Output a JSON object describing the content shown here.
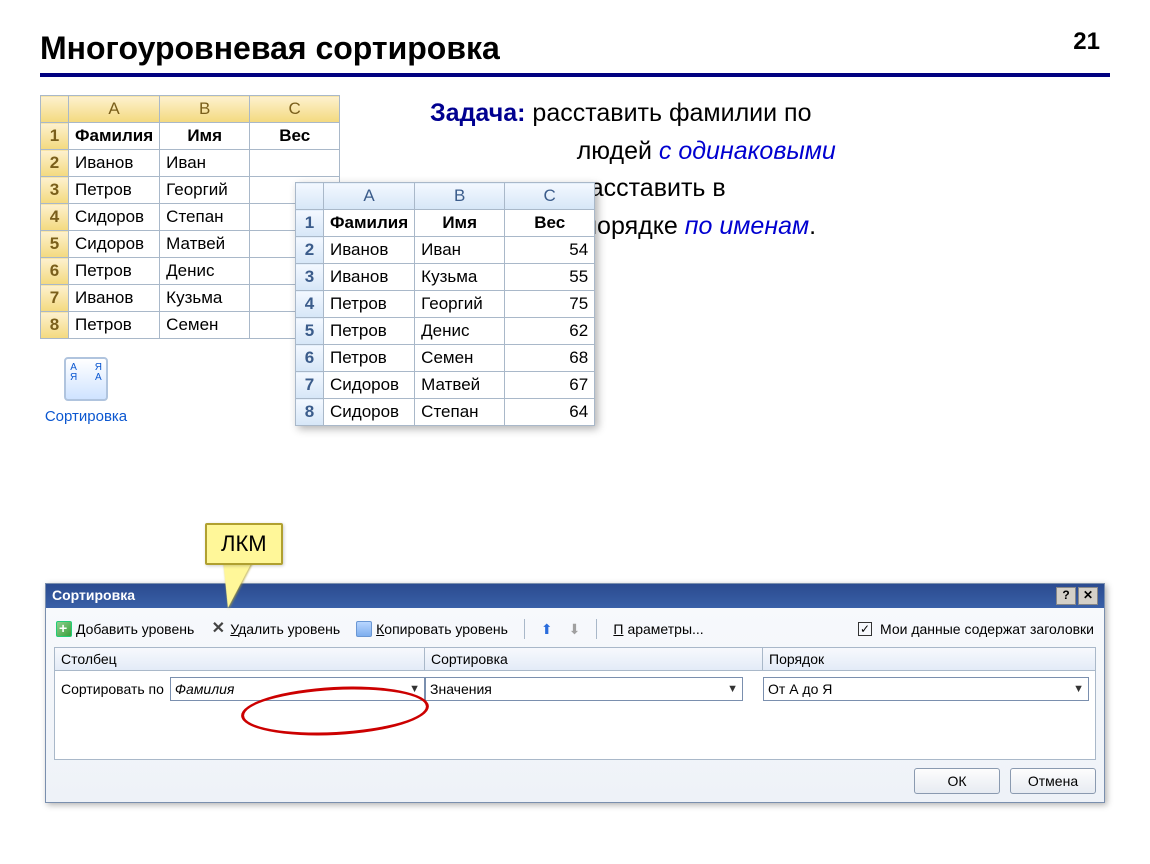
{
  "page_number": "21",
  "title": "Многоуровневая сортировка",
  "task": {
    "label": "Задача:",
    "line1": "  расставить фамилии по",
    "line2a": "людей ",
    "line2b": "с одинаковыми",
    "line3a": "расставить в",
    "line4a": "порядке ",
    "line4b": "по именам",
    "line4c": "."
  },
  "table1": {
    "cols": [
      "A",
      "B",
      "C"
    ],
    "header": [
      "Фамилия",
      "Имя",
      "Вес"
    ],
    "rows": [
      {
        "r": "2",
        "c": [
          "Иванов",
          "Иван",
          ""
        ]
      },
      {
        "r": "3",
        "c": [
          "Петров",
          "Георгий",
          ""
        ]
      },
      {
        "r": "4",
        "c": [
          "Сидоров",
          "Степан",
          ""
        ]
      },
      {
        "r": "5",
        "c": [
          "Сидоров",
          "Матвей",
          ""
        ]
      },
      {
        "r": "6",
        "c": [
          "Петров",
          "Денис",
          ""
        ]
      },
      {
        "r": "7",
        "c": [
          "Иванов",
          "Кузьма",
          ""
        ]
      },
      {
        "r": "8",
        "c": [
          "Петров",
          "Семен",
          ""
        ]
      }
    ],
    "hdr_row": "1"
  },
  "table2": {
    "cols": [
      "A",
      "B",
      "C"
    ],
    "header": [
      "Фамилия",
      "Имя",
      "Вес"
    ],
    "rows": [
      {
        "r": "2",
        "c": [
          "Иванов",
          "Иван",
          "54"
        ]
      },
      {
        "r": "3",
        "c": [
          "Иванов",
          "Кузьма",
          "55"
        ]
      },
      {
        "r": "4",
        "c": [
          "Петров",
          "Георгий",
          "75"
        ]
      },
      {
        "r": "5",
        "c": [
          "Петров",
          "Денис",
          "62"
        ]
      },
      {
        "r": "6",
        "c": [
          "Петров",
          "Семен",
          "68"
        ]
      },
      {
        "r": "7",
        "c": [
          "Сидоров",
          "Матвей",
          "67"
        ]
      },
      {
        "r": "8",
        "c": [
          "Сидоров",
          "Степан",
          "64"
        ]
      }
    ],
    "hdr_row": "1"
  },
  "sort_button_label": "Сортировка",
  "callout": "ЛКМ",
  "dialog": {
    "title": "Сортировка",
    "help_btn": "?",
    "close_btn": "✕",
    "add_level": "Добавить уровень",
    "del_level": "Удалить уровень",
    "copy_level": "Копировать уровень",
    "params": "Параметры...",
    "checkbox_label": "Мои данные содержат заголовки",
    "checkbox_checked": "✓",
    "hdr_col": "Столбец",
    "hdr_sort": "Сортировка",
    "hdr_ord": "Порядок",
    "row_label": "Сортировать по",
    "dd_col": "Фамилия",
    "dd_sort": "Значения",
    "dd_ord": "От А до Я",
    "ok": "ОК",
    "cancel": "Отмена"
  }
}
